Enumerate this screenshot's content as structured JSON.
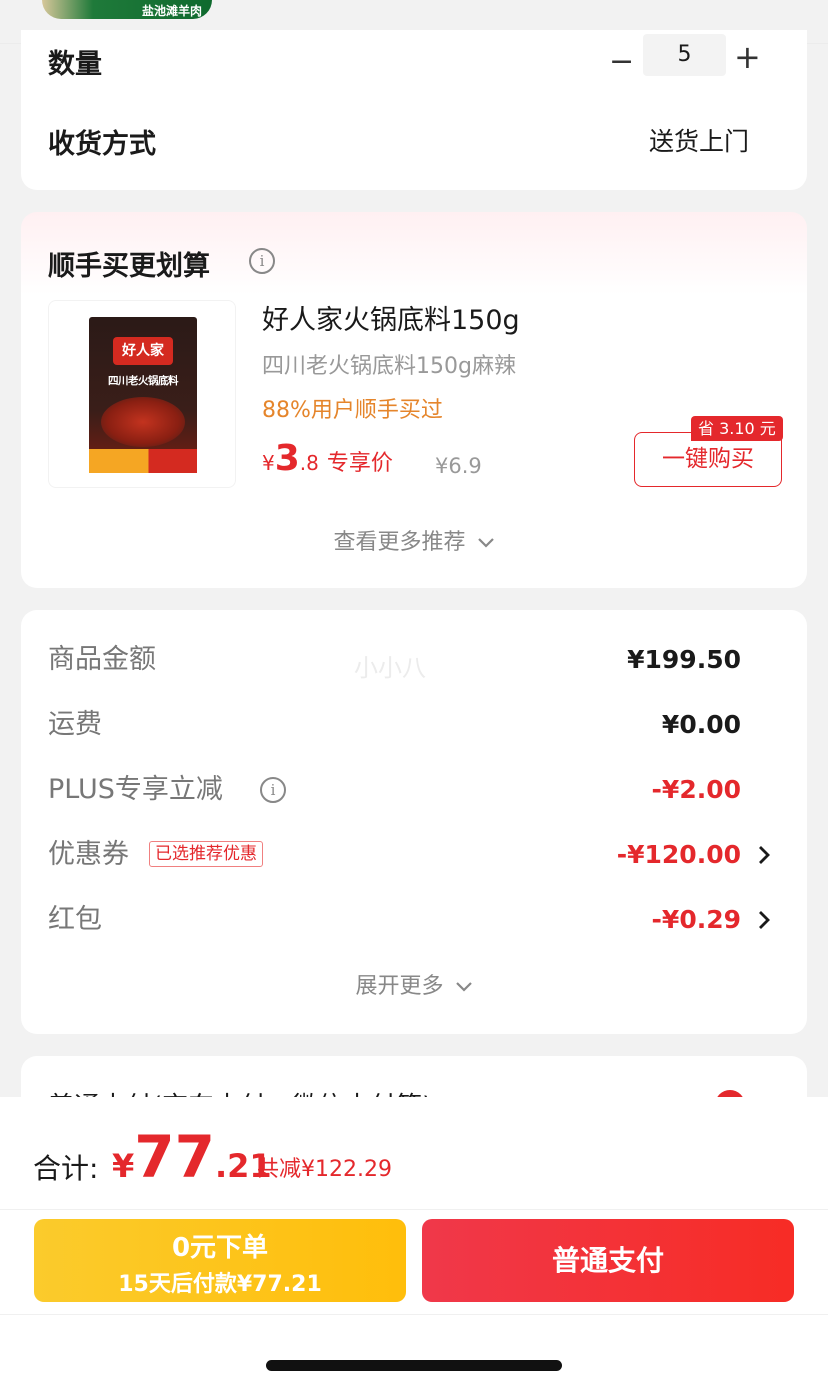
{
  "top": {
    "product_label": "盐池滩羊肉"
  },
  "order": {
    "quantity_label": "数量",
    "quantity_value": "5",
    "quantity_minus": "−",
    "quantity_plus": "+",
    "delivery_label": "收货方式",
    "delivery_value": "送货上门"
  },
  "addon": {
    "title": "顺手买更划算",
    "info_icon": "info-icon",
    "package_brand": "好人家",
    "package_name": "四川老火锅底料",
    "product_name": "好人家火锅底料150g",
    "product_spec": "四川老火锅底料150g麻辣",
    "stat": "88%用户顺手买过",
    "price_yen": "¥",
    "price_int": "3",
    "price_dec": ".8",
    "price_tag": "专享价",
    "original_price": "¥6.9",
    "save_badge": "省 3.10 元",
    "buy_button": "一键购买",
    "more_label": "查看更多推荐"
  },
  "summary": {
    "watermark": "小小八",
    "rows": [
      {
        "label": "商品金额",
        "value": "¥199.50"
      },
      {
        "label": "运费",
        "value": "¥0.00"
      },
      {
        "label": "PLUS专享立减",
        "value": "-¥2.00"
      },
      {
        "label": "优惠券",
        "tag": "已选推荐优惠",
        "value": "-¥120.00"
      },
      {
        "label": "红包",
        "value": "-¥0.29"
      }
    ],
    "expand_label": "展开更多"
  },
  "payment": {
    "partial_text": "普通支付(京东支付、微信支付等)"
  },
  "bottom": {
    "total_label": "合计:",
    "total_yen": "¥",
    "total_int": "77",
    "total_dec": ".21",
    "total_save": "共减¥122.29",
    "zero_main": "0元下单",
    "zero_sub": "15天后付款¥77.21",
    "pay_button": "普通支付"
  },
  "colors": {
    "accent_red": "#e4282c",
    "stat_orange": "#e5852b",
    "zero_yellow": "#fbcb2c"
  }
}
